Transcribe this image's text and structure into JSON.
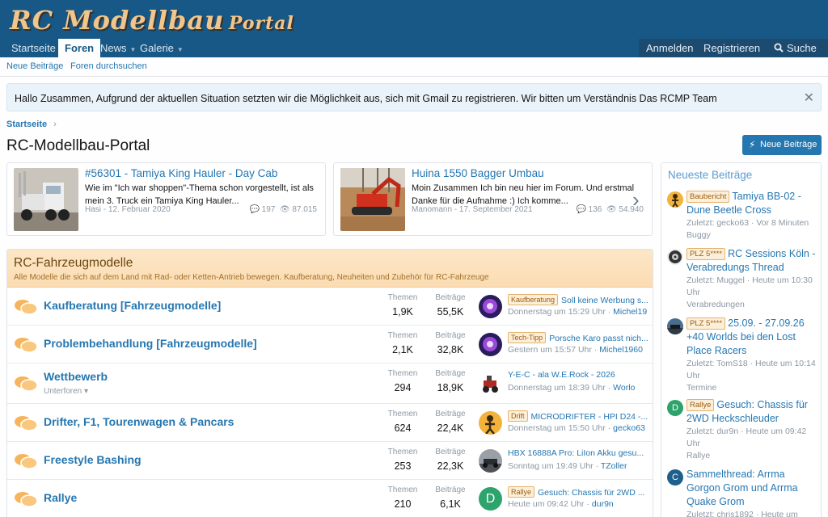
{
  "logo": {
    "part1": "RC Modellbau",
    "part2": "Portal"
  },
  "nav": {
    "items": [
      {
        "label": "Startseite"
      },
      {
        "label": "Foren"
      },
      {
        "label": "News"
      },
      {
        "label": "Galerie"
      }
    ],
    "login": "Anmelden",
    "register": "Registrieren",
    "search": "Suche"
  },
  "subnav": {
    "new_posts": "Neue Beiträge",
    "search_forums": "Foren durchsuchen"
  },
  "notice": "Hallo Zusammen, Aufgrund der aktuellen Situation setzten wir die Möglichkeit aus, sich mit Gmail zu registrieren. Wir bitten um Verständnis Das RCMP Team",
  "breadcrumb": "Startseite",
  "page_title": "RC-Modellbau-Portal",
  "new_posts_button": "Neue Beiträge",
  "featured": [
    {
      "title": "#56301 - Tamiya King Hauler - Day Cab",
      "excerpt": "Wie im \"Ich war shoppen\"-Thema schon vorgestellt, ist als mein 3. Truck ein Tamiya King Hauler...",
      "author": "Hasi",
      "date": "12. Februar 2020",
      "replies": "197",
      "views": "87.015"
    },
    {
      "title": "Huina 1550 Bagger Umbau",
      "excerpt": "Moin Zusammen Ich bin neu hier im Forum. Und erstmal Danke für die Aufnahme :) Ich komme...",
      "author": "Manomann",
      "date": "17. September 2021",
      "replies": "136",
      "views": "54.940"
    }
  ],
  "category": {
    "title": "RC-Fahrzeugmodelle",
    "description": "Alle Modelle die sich auf dem Land mit Rad- oder Ketten-Antrieb bewegen. Kaufberatung, Neuheiten und Zubehör für RC-Fahrzeuge",
    "threads_label": "Themen",
    "posts_label": "Beiträge",
    "forums": [
      {
        "name": "Kaufberatung [Fahrzeugmodelle]",
        "threads": "1,9K",
        "posts": "55,5K",
        "prefix": "Kaufberatung",
        "last_title": "Soll keine Werbung s...",
        "last_time": "Donnerstag um 15:29 Uhr",
        "last_user": "Michel19"
      },
      {
        "name": "Problembehandlung [Fahrzeugmodelle]",
        "threads": "2,1K",
        "posts": "32,8K",
        "prefix": "Tech-Tipp",
        "last_title": "Porsche Karo passt nich...",
        "last_time": "Gestern um 15:57 Uhr",
        "last_user": "Michel1960"
      },
      {
        "name": "Wettbewerb",
        "subforums": "Unterforen",
        "threads": "294",
        "posts": "18,9K",
        "prefix": "",
        "last_title": "Y-E-C - ala W.E.Rock - 2026",
        "last_time": "Donnerstag um 18:39 Uhr",
        "last_user": "Worlo"
      },
      {
        "name": "Drifter, F1, Tourenwagen & Pancars",
        "threads": "624",
        "posts": "22,4K",
        "prefix": "Drift",
        "last_title": "MICRODRIFTER - HPI D24 -...",
        "last_time": "Donnerstag um 15:50 Uhr",
        "last_user": "gecko63"
      },
      {
        "name": "Freestyle Bashing",
        "threads": "253",
        "posts": "22,3K",
        "prefix": "",
        "last_title": "HBX 16888A Pro: LiIon Akku gesu...",
        "last_time": "Sonntag um 19:49 Uhr",
        "last_user": "TZoller"
      },
      {
        "name": "Rallye",
        "threads": "210",
        "posts": "6,1K",
        "prefix": "Rallye",
        "last_title": "Gesuch: Chassis für 2WD ...",
        "last_time": "Heute um 09:42 Uhr",
        "last_user": "dur9n",
        "avatar_letter": "D"
      }
    ]
  },
  "sidebar": {
    "title": "Neueste Beiträge",
    "items": [
      {
        "prefix": "Baubericht",
        "title": "Tamiya BB-02 - Dune Beetle Cross",
        "meta": "Zuletzt: gecko63 · Vor 8 Minuten",
        "forum": "Buggy"
      },
      {
        "prefix": "PLZ 5****",
        "title": "RC Sessions Köln - Verabredungs Thread",
        "meta": "Zuletzt: Muggel · Heute um 10:30 Uhr",
        "forum": "Verabredungen"
      },
      {
        "prefix": "PLZ 5****",
        "title": "25.09. - 27.09.26 +40 Worlds bei den Lost Place Racers",
        "meta": "Zuletzt: TomS18 · Heute um 10:14 Uhr",
        "forum": "Termine"
      },
      {
        "prefix": "Rallye",
        "title": "Gesuch: Chassis für 2WD Heckschleuder",
        "meta": "Zuletzt: dur9n · Heute um 09:42 Uhr",
        "forum": "Rallye",
        "avatar_letter": "D"
      },
      {
        "prefix": "",
        "title": "Sammelthread: Arrma Gorgon Grom und Arrma Quake Grom",
        "meta": "Zuletzt: chris1892 · Heute um",
        "forum": "",
        "avatar_letter": "C"
      }
    ]
  }
}
